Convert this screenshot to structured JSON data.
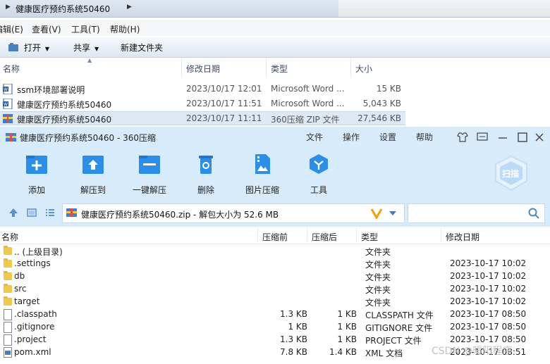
{
  "explorer": {
    "breadcrumb": "健康医疗预约系统50460",
    "menu": [
      "编辑(E)",
      "查看(V)",
      "工具(T)",
      "帮助(H)"
    ],
    "commands": {
      "open": "打开",
      "share": "共享",
      "new_folder": "新建文件夹"
    },
    "columns": [
      "名称",
      "修改日期",
      "类型",
      "大小"
    ],
    "files": [
      {
        "name": "ssm环境部署说明",
        "date": "2023/10/17 12:01",
        "type": "Microsoft Word ...",
        "size": "15 KB",
        "icon": "word-doc-icon"
      },
      {
        "name": "健康医疗预约系统50460",
        "date": "2023/10/17 11:51",
        "type": "Microsoft Word ...",
        "size": "5,043 KB",
        "icon": "word-doc-icon"
      },
      {
        "name": "健康医疗预约系统50460",
        "date": "2023/10/17 11:11",
        "type": "360压缩 ZIP 文件",
        "size": "27,546 KB",
        "icon": "zip-archive-icon"
      }
    ]
  },
  "zip": {
    "title": "健康医疗预约系统50460 - 360压缩",
    "menu": [
      "文件",
      "操作",
      "设置",
      "帮助"
    ],
    "toolbar": [
      "添加",
      "解压到",
      "一键解压",
      "删除",
      "图片压缩",
      "工具"
    ],
    "scan_label": "扫描",
    "path": "健康医疗预约系统50460.zip - 解包大小为 52.6 MB",
    "columns": [
      "名称",
      "压缩前",
      "压缩后",
      "类型",
      "修改日期"
    ],
    "rows": [
      {
        "name": ".. (上级目录)",
        "before": "",
        "after": "",
        "type": "文件夹",
        "date": "",
        "icon": "folder-icon"
      },
      {
        "name": ".settings",
        "before": "",
        "after": "",
        "type": "文件夹",
        "date": "2023-10-17 10:02",
        "icon": "folder-icon"
      },
      {
        "name": "db",
        "before": "",
        "after": "",
        "type": "文件夹",
        "date": "2023-10-17 10:02",
        "icon": "folder-icon"
      },
      {
        "name": "src",
        "before": "",
        "after": "",
        "type": "文件夹",
        "date": "2023-10-17 10:02",
        "icon": "folder-icon"
      },
      {
        "name": "target",
        "before": "",
        "after": "",
        "type": "文件夹",
        "date": "2023-10-17 10:02",
        "icon": "folder-icon"
      },
      {
        "name": ".classpath",
        "before": "1.3 KB",
        "after": "1 KB",
        "type": "CLASSPATH 文件",
        "date": "2023-10-17 08:50",
        "icon": "file-icon"
      },
      {
        "name": ".gitignore",
        "before": "1 KB",
        "after": "1 KB",
        "type": "GITIGNORE 文件",
        "date": "2023-10-17 08:50",
        "icon": "file-icon"
      },
      {
        "name": ".project",
        "before": "1.3 KB",
        "after": "1 KB",
        "type": "PROJECT 文件",
        "date": "2023-10-17 08:50",
        "icon": "file-icon"
      },
      {
        "name": "pom.xml",
        "before": "7.8 KB",
        "after": "1.4 KB",
        "type": "XML 文档",
        "date": "2023-10-17 08:51",
        "icon": "xml-file-icon"
      }
    ],
    "watermark": "CSDN @暖阳程序"
  },
  "colors": {
    "zip_toolbar_bg": "#d8ebfb",
    "accent_blue": "#2b8ee8",
    "selection": "#dfe9f5"
  }
}
